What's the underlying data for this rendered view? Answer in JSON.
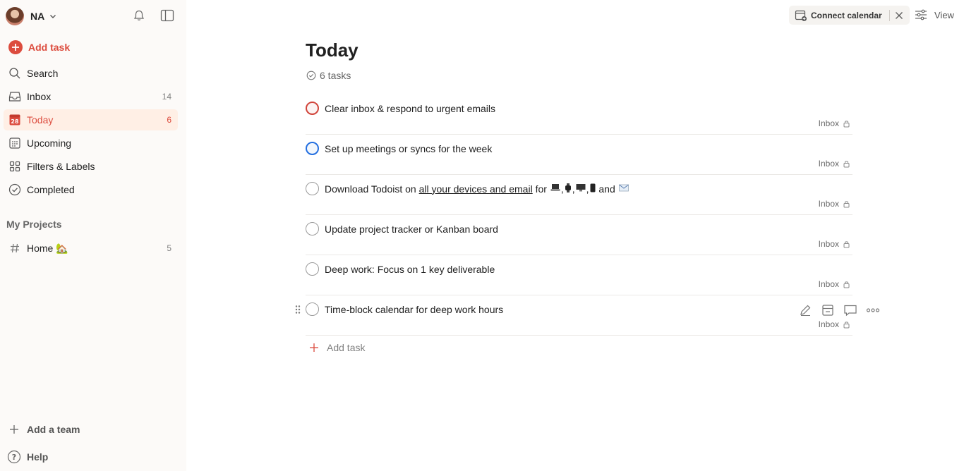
{
  "user": {
    "name": "NA"
  },
  "sidebar": {
    "add_task": "Add task",
    "items": [
      {
        "label": "Search",
        "count": ""
      },
      {
        "label": "Inbox",
        "count": "14"
      },
      {
        "label": "Today",
        "count": "6",
        "calendar_day": "28"
      },
      {
        "label": "Upcoming",
        "count": ""
      },
      {
        "label": "Filters & Labels",
        "count": ""
      },
      {
        "label": "Completed",
        "count": ""
      }
    ],
    "projects_title": "My Projects",
    "projects": [
      {
        "label": "Home 🏡",
        "count": "5"
      }
    ],
    "add_team": "Add a team",
    "help": "Help"
  },
  "topbar": {
    "connect_calendar": "Connect calendar",
    "view": "View"
  },
  "main": {
    "title": "Today",
    "task_count": "6 tasks",
    "tasks": [
      {
        "title": "Clear inbox & respond to urgent emails",
        "project": "Inbox",
        "priority": "p1"
      },
      {
        "title": "Set up meetings or syncs for the week",
        "project": "Inbox",
        "priority": "p2"
      },
      {
        "title_prefix": "Download Todoist on ",
        "title_link": "all your devices and email",
        "title_mid": " for ",
        "title_and": " and ",
        "project": "Inbox",
        "priority": "p4"
      },
      {
        "title": "Update project tracker or Kanban board",
        "project": "Inbox",
        "priority": "p4"
      },
      {
        "title": "Deep work: Focus on 1 key deliverable",
        "project": "Inbox",
        "priority": "p4"
      },
      {
        "title": "Time-block calendar for deep work hours",
        "project": "Inbox",
        "priority": "p4"
      }
    ],
    "add_task": "Add task"
  },
  "colors": {
    "accent": "#dc4c3e",
    "p1": "#d1453b",
    "p2": "#246fe0",
    "sidebar_bg": "#fcfaf8",
    "active_bg": "#ffefe5"
  }
}
